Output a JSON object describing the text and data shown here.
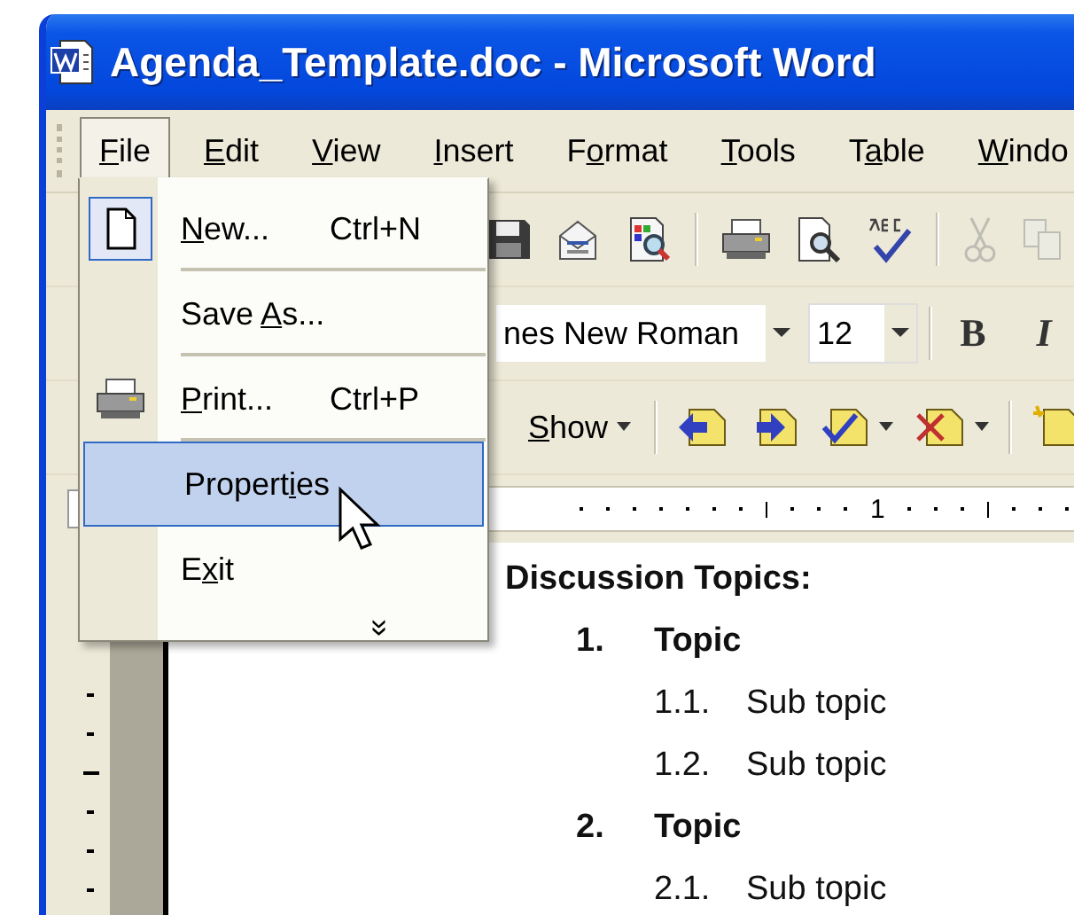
{
  "window": {
    "title": "Agenda_Template.doc - Microsoft Word"
  },
  "menu_bar": [
    {
      "label": {
        "key": "F",
        "after": "ile"
      },
      "selected": true
    },
    {
      "label": {
        "key": "E",
        "after": "dit"
      },
      "selected": false
    },
    {
      "label": {
        "key": "V",
        "after": "iew"
      },
      "selected": false
    },
    {
      "label": {
        "key": "I",
        "after": "nsert"
      },
      "selected": false
    },
    {
      "label": {
        "before": "F",
        "key": "o",
        "after": "rmat"
      },
      "selected": false
    },
    {
      "label": {
        "key": "T",
        "after": "ools"
      },
      "selected": false
    },
    {
      "label": {
        "before": "T",
        "key": "a",
        "after": "ble"
      },
      "selected": false
    },
    {
      "label": {
        "key": "W",
        "after": "indo"
      },
      "selected": false
    }
  ],
  "file_menu": [
    {
      "kind": "new",
      "label": {
        "key": "N",
        "after": "ew..."
      },
      "shortcut": "Ctrl+N",
      "selected": false
    },
    {
      "kind": "save_as",
      "label": {
        "before": "Save ",
        "key": "A",
        "after": "s..."
      },
      "selected": false
    },
    {
      "kind": "print",
      "label": {
        "key": "P",
        "after": "rint..."
      },
      "shortcut": "Ctrl+P",
      "selected": false
    },
    {
      "kind": "properties",
      "label": {
        "before": "Propert",
        "key": "i",
        "after": "es"
      },
      "selected": true
    },
    {
      "kind": "exit",
      "label": {
        "before": "E",
        "key": "x",
        "after": "it"
      },
      "selected": false
    },
    {
      "kind": "expand",
      "label": {
        "before": "»"
      },
      "selected": false
    }
  ],
  "standard_toolbar": [
    {
      "kind": "save",
      "disabled": false
    },
    {
      "kind": "email",
      "disabled": false
    },
    {
      "kind": "permission",
      "disabled": false
    },
    {
      "kind": "separator"
    },
    {
      "kind": "print",
      "disabled": false
    },
    {
      "kind": "preview",
      "disabled": false
    },
    {
      "kind": "spelling",
      "disabled": false
    },
    {
      "kind": "separator"
    },
    {
      "kind": "cut",
      "disabled": true
    },
    {
      "kind": "copy",
      "disabled": true
    }
  ],
  "formatting_toolbar": {
    "font": "nes New Roman",
    "size": "12",
    "bold": "B",
    "italic": "I"
  },
  "reviewing_toolbar": {
    "show": {
      "label": {
        "key": "S",
        "after": "how"
      }
    },
    "tools": [
      {
        "kind": "previous"
      },
      {
        "kind": "next"
      },
      {
        "kind": "accept"
      },
      {
        "kind": "dropdown"
      },
      {
        "kind": "reject"
      },
      {
        "kind": "dropdown"
      },
      {
        "kind": "separator"
      },
      {
        "kind": "new_comment"
      }
    ]
  },
  "ruler": {
    "label": "1"
  },
  "document": {
    "heading": "Discussion Topics:",
    "topics": [
      {
        "number": "1.",
        "text": "Topic",
        "children": [
          {
            "number": "1.1.",
            "text": "Sub topic"
          },
          {
            "number": "1.2.",
            "text": "Sub topic"
          }
        ]
      },
      {
        "number": "2.",
        "text": "Topic",
        "children": [
          {
            "number": "2.1.",
            "text": "Sub topic"
          }
        ]
      }
    ]
  }
}
